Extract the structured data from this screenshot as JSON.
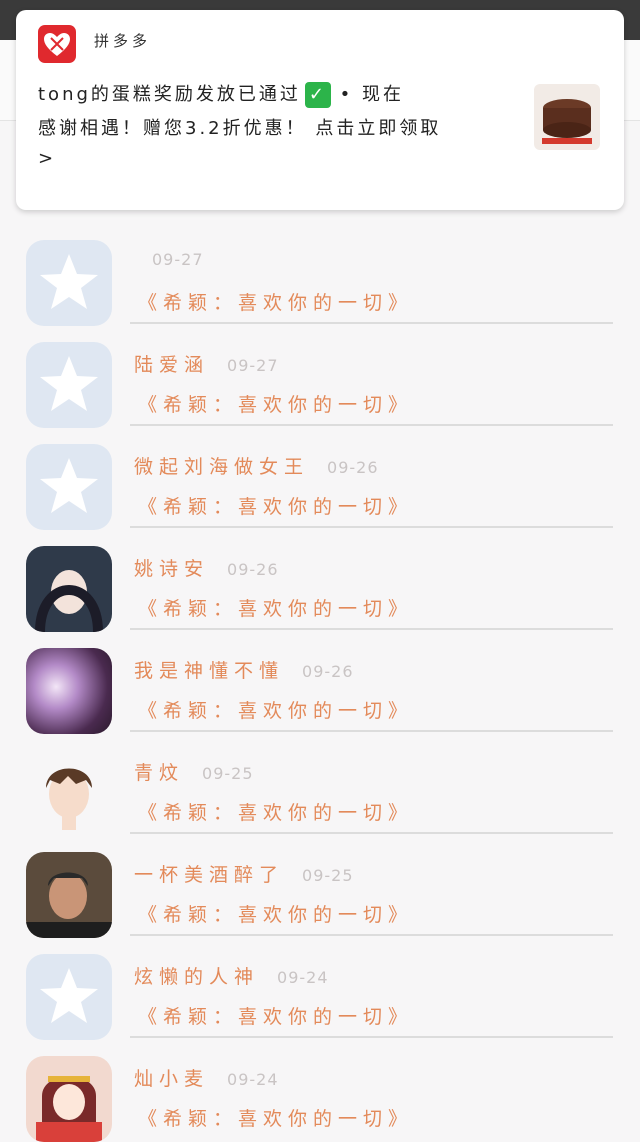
{
  "notification": {
    "app_name": "拼多多",
    "line1": "tong的蛋糕奖励发放已通过",
    "check": "✓",
    "time_prefix": "• 现在",
    "line2": "感谢相遇！赠您3.2折优惠！ 点击立即领取",
    "line3": ">"
  },
  "header": {
    "back": "‹",
    "title": ""
  },
  "messages": [
    {
      "name": "",
      "date": "09-27",
      "text": "《希颖：喜欢你的一切》"
    },
    {
      "name": "陆爱涵",
      "date": "09-27",
      "text": "《希颖：喜欢你的一切》"
    },
    {
      "name": "微起刘海做女王",
      "date": "09-26",
      "text": "《希颖：喜欢你的一切》"
    },
    {
      "name": "姚诗安",
      "date": "09-26",
      "text": "《希颖：喜欢你的一切》"
    },
    {
      "name": "我是神懂不懂",
      "date": "09-26",
      "text": "《希颖：喜欢你的一切》"
    },
    {
      "name": "青炆",
      "date": "09-25",
      "text": "《希颖：喜欢你的一切》"
    },
    {
      "name": "一杯美酒醉了",
      "date": "09-25",
      "text": "《希颖：喜欢你的一切》"
    },
    {
      "name": "炫懒的人神",
      "date": "09-24",
      "text": "《希颖：喜欢你的一切》"
    },
    {
      "name": "灿小麦",
      "date": "09-24",
      "text": "《希颖：喜欢你的一切》"
    }
  ],
  "colors": {
    "accent": "#e38a5a",
    "date": "#c9c4c4",
    "qq_default": "#dfe7f2",
    "pdd_red": "#e0292e"
  }
}
